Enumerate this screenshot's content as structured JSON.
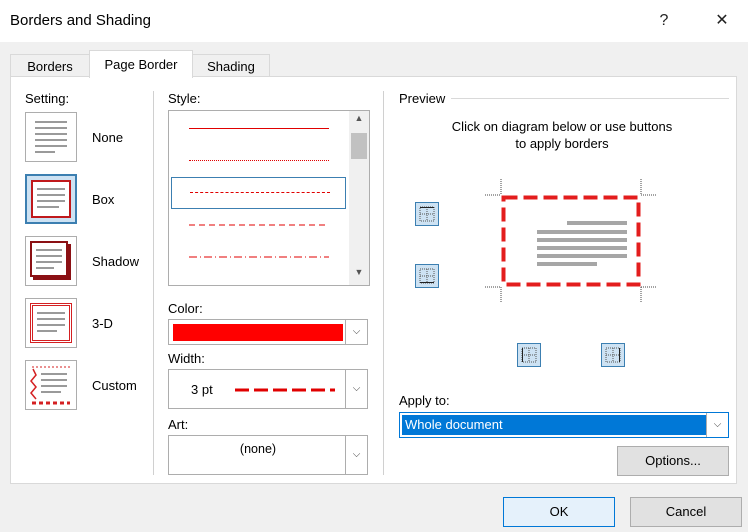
{
  "window": {
    "title": "Borders and Shading",
    "help_glyph": "?",
    "close_glyph": "✕"
  },
  "tabs": [
    {
      "label": "Borders",
      "active": false
    },
    {
      "label": "Page Border",
      "active": true
    },
    {
      "label": "Shading",
      "active": false
    }
  ],
  "setting": {
    "label": "Setting:",
    "items": [
      {
        "label": "None",
        "selected": false
      },
      {
        "label": "Box",
        "selected": true
      },
      {
        "label": "Shadow",
        "selected": false
      },
      {
        "label": "3-D",
        "selected": false
      },
      {
        "label": "Custom",
        "selected": false
      }
    ]
  },
  "style": {
    "label": "Style:",
    "selected_index": 2
  },
  "color": {
    "label": "Color:",
    "value": "#ff0000"
  },
  "width": {
    "label": "Width:",
    "value": "3 pt"
  },
  "art": {
    "label": "Art:",
    "value": "(none)"
  },
  "preview": {
    "label": "Preview",
    "instructions_line1": "Click on diagram below or use buttons",
    "instructions_line2": "to apply borders"
  },
  "apply_to": {
    "label": "Apply to:",
    "value": "Whole document"
  },
  "buttons": {
    "options": "Options...",
    "ok": "OK",
    "cancel": "Cancel"
  },
  "colors": {
    "accent": "#0078d7",
    "border_red": "#e31d1d"
  }
}
